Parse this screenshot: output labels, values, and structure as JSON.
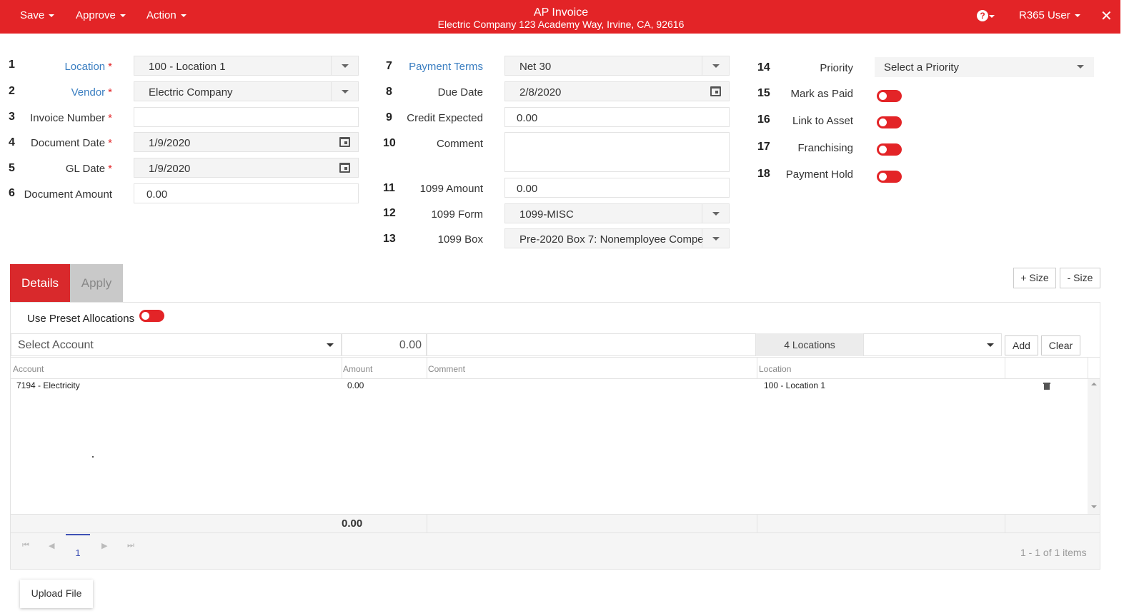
{
  "header": {
    "menu": [
      "Save",
      "Approve",
      "Action"
    ],
    "title": "AP Invoice",
    "subtitle": "Electric Company 123 Academy Way, Irvine, CA, 92616",
    "user": "R365 User",
    "help_icon": "question-circle-icon",
    "close_icon": "close-icon",
    "bar_color": "#e32427"
  },
  "fields": {
    "location": {
      "num": "1",
      "label": "Location",
      "value": "100 - Location 1"
    },
    "vendor": {
      "num": "2",
      "label": "Vendor",
      "value": "Electric Company"
    },
    "invoice_number": {
      "num": "3",
      "label": "Invoice Number",
      "value": ""
    },
    "document_date": {
      "num": "4",
      "label": "Document Date",
      "value": "1/9/2020"
    },
    "gl_date": {
      "num": "5",
      "label": "GL Date",
      "value": "1/9/2020"
    },
    "document_amount": {
      "num": "6",
      "label": "Document Amount",
      "value": "0.00"
    },
    "payment_terms": {
      "num": "7",
      "label": "Payment Terms",
      "value": "Net 30"
    },
    "due_date": {
      "num": "8",
      "label": "Due Date",
      "value": "2/8/2020"
    },
    "credit_expected": {
      "num": "9",
      "label": "Credit Expected",
      "value": "0.00"
    },
    "comment": {
      "num": "10",
      "label": "Comment",
      "value": ""
    },
    "amount_1099": {
      "num": "11",
      "label": "1099 Amount",
      "value": "0.00"
    },
    "form_1099": {
      "num": "12",
      "label": "1099 Form",
      "value": "1099-MISC"
    },
    "box_1099": {
      "num": "13",
      "label": "1099 Box",
      "value": "Pre-2020 Box 7: Nonemployee Compe"
    },
    "priority": {
      "num": "14",
      "label": "Priority",
      "value": "Select a Priority"
    },
    "mark_as_paid": {
      "num": "15",
      "label": "Mark as Paid"
    },
    "link_to_asset": {
      "num": "16",
      "label": "Link to Asset"
    },
    "franchising": {
      "num": "17",
      "label": "Franchising"
    },
    "payment_hold": {
      "num": "18",
      "label": "Payment Hold"
    },
    "required_marker": "*"
  },
  "tabs": {
    "details": "Details",
    "apply": "Apply"
  },
  "size_buttons": {
    "plus": "+ Size",
    "minus": "- Size"
  },
  "details": {
    "preset_label": "Use Preset Allocations",
    "account_placeholder": "Select Account",
    "amount_value": "0.00",
    "locations_badge": "4 Locations",
    "add_label": "Add",
    "clear_label": "Clear",
    "columns": [
      "Account",
      "Amount",
      "Comment",
      "Location"
    ],
    "rows": [
      {
        "account": "7194 - Electricity",
        "amount": "0.00",
        "comment": "",
        "location": "100 - Location 1"
      }
    ],
    "total": "0.00",
    "pager": {
      "current": "1",
      "info": "1 - 1 of 1 items"
    }
  },
  "upload_label": "Upload File"
}
